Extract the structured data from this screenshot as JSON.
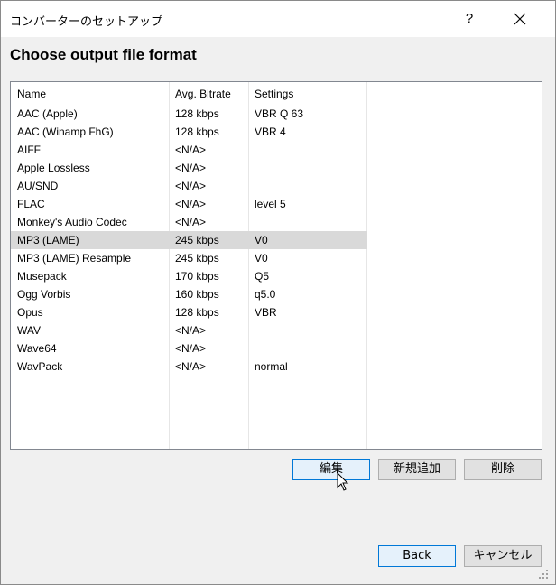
{
  "window": {
    "title": "コンバーターのセットアップ",
    "help_label": "?"
  },
  "page": {
    "heading": "Choose output file format"
  },
  "table": {
    "columns": [
      "Name",
      "Avg. Bitrate",
      "Settings"
    ],
    "rows": [
      {
        "name": "AAC (Apple)",
        "bitrate": "128 kbps",
        "settings": "VBR Q 63"
      },
      {
        "name": "AAC (Winamp FhG)",
        "bitrate": "128 kbps",
        "settings": "VBR 4"
      },
      {
        "name": "AIFF",
        "bitrate": "<N/A>",
        "settings": ""
      },
      {
        "name": "Apple Lossless",
        "bitrate": "<N/A>",
        "settings": ""
      },
      {
        "name": "AU/SND",
        "bitrate": "<N/A>",
        "settings": ""
      },
      {
        "name": "FLAC",
        "bitrate": "<N/A>",
        "settings": "level 5"
      },
      {
        "name": "Monkey's Audio Codec",
        "bitrate": "<N/A>",
        "settings": ""
      },
      {
        "name": "MP3 (LAME)",
        "bitrate": "245 kbps",
        "settings": "V0",
        "selected": true
      },
      {
        "name": "MP3 (LAME) Resample",
        "bitrate": "245 kbps",
        "settings": "V0"
      },
      {
        "name": "Musepack",
        "bitrate": "170 kbps",
        "settings": "Q5"
      },
      {
        "name": "Ogg Vorbis",
        "bitrate": "160 kbps",
        "settings": "q5.0"
      },
      {
        "name": "Opus",
        "bitrate": "128 kbps",
        "settings": "VBR"
      },
      {
        "name": "WAV",
        "bitrate": "<N/A>",
        "settings": ""
      },
      {
        "name": "Wave64",
        "bitrate": "<N/A>",
        "settings": ""
      },
      {
        "name": "WavPack",
        "bitrate": "<N/A>",
        "settings": "normal"
      }
    ]
  },
  "buttons": {
    "edit": "編集",
    "add_new": "新規追加",
    "delete": "削除",
    "back": "Back",
    "cancel": "キャンセル"
  },
  "colors": {
    "selected_row": "#d9d9d9",
    "focus_border": "#0078d7"
  }
}
